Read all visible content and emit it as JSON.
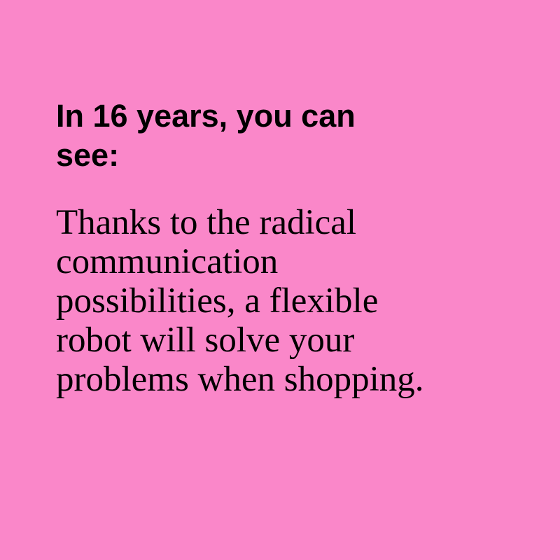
{
  "card": {
    "background_color": "#fa87c9",
    "text_color": "#000000",
    "heading_lines": [
      "In 16 years, you can",
      "see:"
    ],
    "body_lines": [
      "Thanks to the radical",
      "communication",
      "possibilities, a flexible",
      "robot will solve your",
      "problems when shopping."
    ]
  }
}
